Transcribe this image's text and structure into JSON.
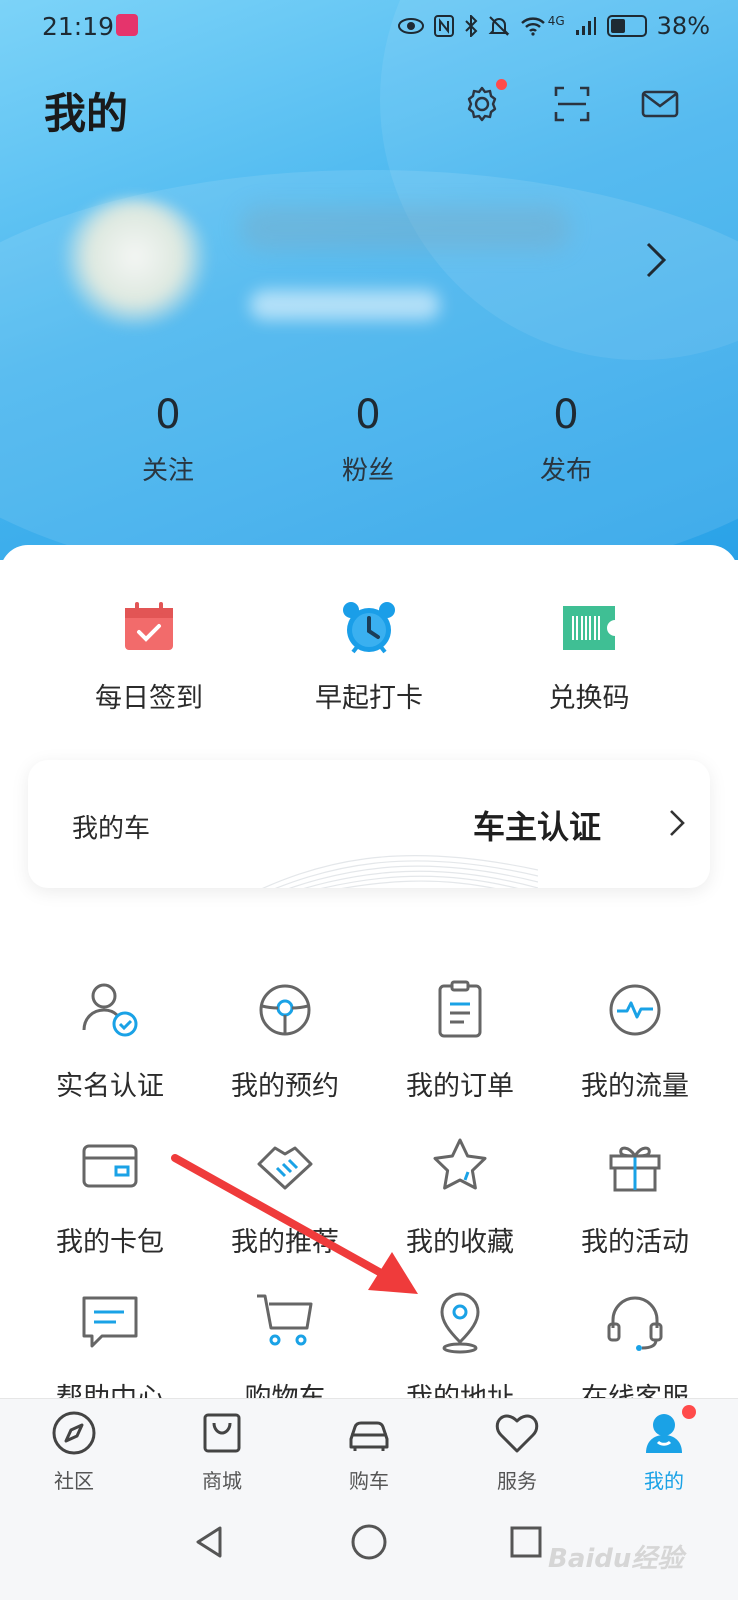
{
  "status_bar": {
    "time": "21:19",
    "battery_pct": "38%",
    "signal_text": "4G"
  },
  "header": {
    "title": "我的"
  },
  "stats": [
    {
      "value": "0",
      "label": "关注"
    },
    {
      "value": "0",
      "label": "粉丝"
    },
    {
      "value": "0",
      "label": "发布"
    }
  ],
  "quick_actions": [
    {
      "label": "每日签到",
      "icon": "calendar-check-icon"
    },
    {
      "label": "早起打卡",
      "icon": "alarm-clock-icon"
    },
    {
      "label": "兑换码",
      "icon": "barcode-ticket-icon"
    }
  ],
  "car_card": {
    "label": "我的车",
    "action": "车主认证"
  },
  "grid": [
    {
      "label": "实名认证",
      "icon": "user-verified-icon"
    },
    {
      "label": "我的预约",
      "icon": "steering-wheel-icon"
    },
    {
      "label": "我的订单",
      "icon": "order-list-icon"
    },
    {
      "label": "我的流量",
      "icon": "traffic-pulse-icon"
    },
    {
      "label": "我的卡包",
      "icon": "card-wallet-icon"
    },
    {
      "label": "我的推荐",
      "icon": "handshake-icon"
    },
    {
      "label": "我的收藏",
      "icon": "star-icon"
    },
    {
      "label": "我的活动",
      "icon": "gift-icon"
    },
    {
      "label": "帮助中心",
      "icon": "help-chat-icon"
    },
    {
      "label": "购物车",
      "icon": "shopping-cart-icon"
    },
    {
      "label": "我的地址",
      "icon": "location-pin-icon"
    },
    {
      "label": "在线客服",
      "icon": "headset-icon"
    }
  ],
  "tabs": [
    {
      "label": "社区",
      "icon": "compass-icon"
    },
    {
      "label": "商城",
      "icon": "shopping-bag-icon"
    },
    {
      "label": "购车",
      "icon": "car-icon"
    },
    {
      "label": "服务",
      "icon": "heart-icon"
    },
    {
      "label": "我的",
      "icon": "profile-icon",
      "active": true
    }
  ],
  "watermark": "Baidu经验",
  "colors": {
    "accent": "#1aa2e6",
    "header_top": "#7cd3f8",
    "header_bottom": "#2aa2e8",
    "badge": "#ff4b4b",
    "arrow": "#ef3b3b"
  }
}
